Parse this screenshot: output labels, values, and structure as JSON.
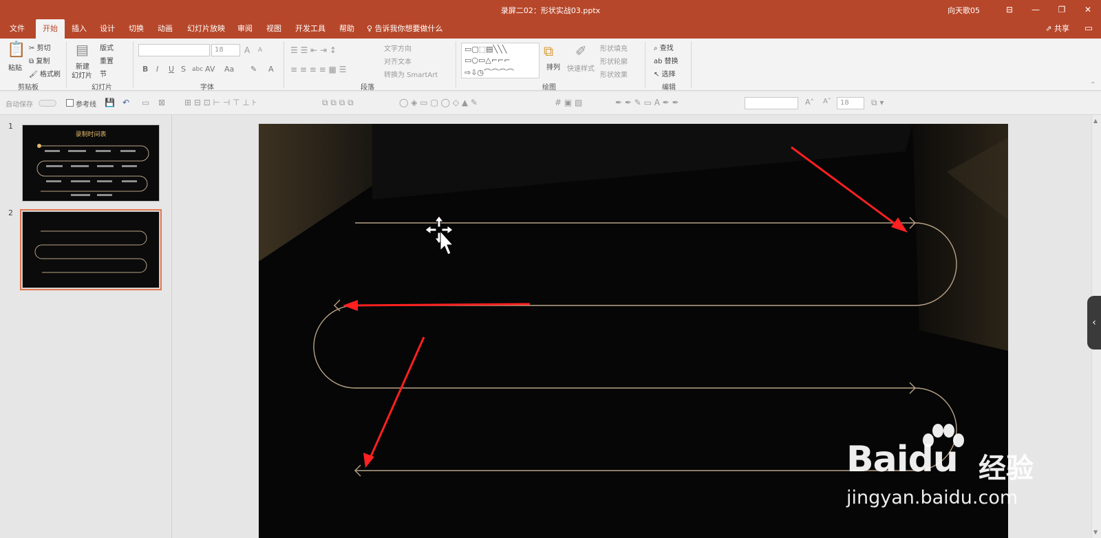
{
  "window": {
    "title": "录屏二02：形状实战03.pptx",
    "user": "向天歌05",
    "controls": {
      "ribbon_display": "⊟",
      "minimize": "—",
      "restore": "❐",
      "close": "✕"
    }
  },
  "tabs": [
    {
      "label": "文件",
      "active": false
    },
    {
      "label": "开始",
      "active": true
    },
    {
      "label": "插入",
      "active": false
    },
    {
      "label": "设计",
      "active": false
    },
    {
      "label": "切换",
      "active": false
    },
    {
      "label": "动画",
      "active": false
    },
    {
      "label": "幻灯片放映",
      "active": false
    },
    {
      "label": "审阅",
      "active": false
    },
    {
      "label": "视图",
      "active": false
    },
    {
      "label": "开发工具",
      "active": false
    },
    {
      "label": "帮助",
      "active": false
    }
  ],
  "tell_me": "告诉我你想要做什么",
  "share": "共享",
  "ribbon": {
    "clipboard": {
      "paste": "粘贴",
      "cut": "剪切",
      "copy": "复制",
      "painter": "格式刷",
      "label": "剪贴板"
    },
    "slides": {
      "new_slide": "新建",
      "new_slide_line2": "幻灯片",
      "layout": "版式",
      "reset": "重置",
      "section": "节",
      "label": "幻灯片"
    },
    "font": {
      "size": "18",
      "label": "字体",
      "bold": "B",
      "italic": "I",
      "underline": "U",
      "strike": "S",
      "shadow": "abc",
      "spacing": "AV",
      "case": "Aa",
      "grow": "A",
      "shrink": "A"
    },
    "paragraph": {
      "text_direction": "文字方向",
      "align_text": "对齐文本",
      "smartart": "转换为 SmartArt",
      "label": "段落"
    },
    "drawing": {
      "arrange": "排列",
      "quick_styles": "快速样式",
      "fill": "形状填充",
      "outline": "形状轮廓",
      "effects": "形状效果",
      "label": "绘图"
    },
    "editing": {
      "find": "查找",
      "replace": "替换",
      "select": "选择",
      "label": "编辑"
    }
  },
  "qat": {
    "autosave": "自动保存",
    "guides": "参考线",
    "font_size": "18"
  },
  "slides": [
    {
      "number": "1",
      "title": "录制时间表",
      "selected": false
    },
    {
      "number": "2",
      "title": "",
      "selected": true
    }
  ],
  "watermark": {
    "logo": "Bai",
    "logo2": "du",
    "cn": "经验",
    "url": "jingyan.baidu.com"
  },
  "colors": {
    "accent": "#b7472a",
    "line": "#b9a387",
    "arrow": "#ff2020"
  }
}
